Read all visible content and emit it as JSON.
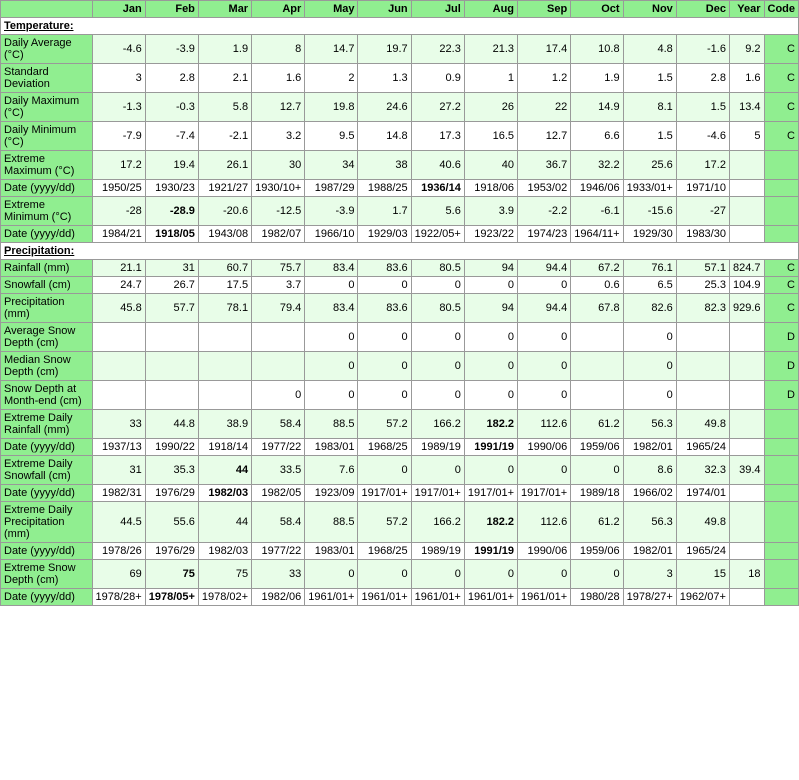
{
  "headers": [
    "",
    "Jan",
    "Feb",
    "Mar",
    "Apr",
    "May",
    "Jun",
    "Jul",
    "Aug",
    "Sep",
    "Oct",
    "Nov",
    "Dec",
    "Year",
    "Code"
  ],
  "sections": [
    {
      "title": "Temperature:",
      "rows": [
        {
          "label": "Daily Average (°C)",
          "values": [
            "-4.6",
            "-3.9",
            "1.9",
            "8",
            "14.7",
            "19.7",
            "22.3",
            "21.3",
            "17.4",
            "10.8",
            "4.8",
            "-1.6",
            "9.2",
            "C"
          ]
        },
        {
          "label": "Standard Deviation",
          "values": [
            "3",
            "2.8",
            "2.1",
            "1.6",
            "2",
            "1.3",
            "0.9",
            "1",
            "1.2",
            "1.9",
            "1.5",
            "2.8",
            "1.6",
            "C"
          ]
        },
        {
          "label": "Daily Maximum (°C)",
          "values": [
            "-1.3",
            "-0.3",
            "5.8",
            "12.7",
            "19.8",
            "24.6",
            "27.2",
            "26",
            "22",
            "14.9",
            "8.1",
            "1.5",
            "13.4",
            "C"
          ]
        },
        {
          "label": "Daily Minimum (°C)",
          "values": [
            "-7.9",
            "-7.4",
            "-2.1",
            "3.2",
            "9.5",
            "14.8",
            "17.3",
            "16.5",
            "12.7",
            "6.6",
            "1.5",
            "-4.6",
            "5",
            "C"
          ]
        },
        {
          "label": "Extreme Maximum (°C)",
          "values": [
            "17.2",
            "19.4",
            "26.1",
            "30",
            "34",
            "38",
            "40.6",
            "40",
            "36.7",
            "32.2",
            "25.6",
            "17.2",
            "",
            ""
          ]
        },
        {
          "label": "Date (yyyy/dd)",
          "values": [
            "1950/25",
            "1930/23",
            "1921/27",
            "1930/10+",
            "1987/29",
            "1988/25",
            "1936/14",
            "1918/06",
            "1953/02",
            "1946/06",
            "1933/01+",
            "1971/10",
            "",
            ""
          ],
          "bold_indices": [
            6
          ]
        },
        {
          "label": "Extreme Minimum (°C)",
          "values": [
            "-28",
            "-28.9",
            "-20.6",
            "-12.5",
            "-3.9",
            "1.7",
            "5.6",
            "3.9",
            "-2.2",
            "-6.1",
            "-15.6",
            "-27",
            "",
            ""
          ],
          "bold_indices": [
            1
          ]
        },
        {
          "label": "Date (yyyy/dd)",
          "values": [
            "1984/21",
            "1918/05",
            "1943/08",
            "1982/07",
            "1966/10",
            "1929/03",
            "1922/05+",
            "1923/22",
            "1974/23",
            "1964/11+",
            "1929/30",
            "1983/30",
            "",
            ""
          ],
          "bold_indices": [
            1
          ]
        }
      ]
    },
    {
      "title": "Precipitation:",
      "rows": [
        {
          "label": "Rainfall (mm)",
          "values": [
            "21.1",
            "31",
            "60.7",
            "75.7",
            "83.4",
            "83.6",
            "80.5",
            "94",
            "94.4",
            "67.2",
            "76.1",
            "57.1",
            "824.7",
            "C"
          ]
        },
        {
          "label": "Snowfall (cm)",
          "values": [
            "24.7",
            "26.7",
            "17.5",
            "3.7",
            "0",
            "0",
            "0",
            "0",
            "0",
            "0.6",
            "6.5",
            "25.3",
            "104.9",
            "C"
          ]
        },
        {
          "label": "Precipitation (mm)",
          "values": [
            "45.8",
            "57.7",
            "78.1",
            "79.4",
            "83.4",
            "83.6",
            "80.5",
            "94",
            "94.4",
            "67.8",
            "82.6",
            "82.3",
            "929.6",
            "C"
          ]
        },
        {
          "label": "Average Snow Depth (cm)",
          "values": [
            "",
            "",
            "",
            "",
            "0",
            "0",
            "0",
            "0",
            "0",
            "",
            "0",
            "",
            "",
            "D"
          ]
        },
        {
          "label": "Median Snow Depth (cm)",
          "values": [
            "",
            "",
            "",
            "",
            "0",
            "0",
            "0",
            "0",
            "0",
            "",
            "0",
            "",
            "",
            "D"
          ]
        },
        {
          "label": "Snow Depth at Month-end (cm)",
          "values": [
            "",
            "",
            "",
            "0",
            "0",
            "0",
            "0",
            "0",
            "0",
            "",
            "0",
            "",
            "",
            "D"
          ]
        },
        {
          "label": "Extreme Daily Rainfall (mm)",
          "values": [
            "33",
            "44.8",
            "38.9",
            "58.4",
            "88.5",
            "57.2",
            "166.2",
            "182.2",
            "112.6",
            "61.2",
            "56.3",
            "49.8",
            "",
            ""
          ],
          "bold_indices": [
            7
          ]
        },
        {
          "label": "Date (yyyy/dd)",
          "values": [
            "1937/13",
            "1990/22",
            "1918/14",
            "1977/22",
            "1983/01",
            "1968/25",
            "1989/19",
            "1991/19",
            "1990/06",
            "1959/06",
            "1982/01",
            "1965/24",
            "",
            ""
          ],
          "bold_indices": [
            7
          ]
        },
        {
          "label": "Extreme Daily Snowfall (cm)",
          "values": [
            "31",
            "35.3",
            "44",
            "33.5",
            "7.6",
            "0",
            "0",
            "0",
            "0",
            "0",
            "8.6",
            "32.3",
            "39.4",
            ""
          ],
          "bold_indices": [
            2
          ]
        },
        {
          "label": "Date (yyyy/dd)",
          "values": [
            "1982/31",
            "1976/29",
            "1982/03",
            "1982/05",
            "1923/09",
            "1917/01+",
            "1917/01+",
            "1917/01+",
            "1917/01+",
            "1989/18",
            "1966/02",
            "1974/01",
            "",
            ""
          ],
          "bold_indices": [
            2
          ]
        },
        {
          "label": "Extreme Daily Precipitation (mm)",
          "values": [
            "44.5",
            "55.6",
            "44",
            "58.4",
            "88.5",
            "57.2",
            "166.2",
            "182.2",
            "112.6",
            "61.2",
            "56.3",
            "49.8",
            "",
            ""
          ],
          "bold_indices": [
            7
          ]
        },
        {
          "label": "Date (yyyy/dd)",
          "values": [
            "1978/26",
            "1976/29",
            "1982/03",
            "1977/22",
            "1983/01",
            "1968/25",
            "1989/19",
            "1991/19",
            "1990/06",
            "1959/06",
            "1982/01",
            "1965/24",
            "",
            ""
          ],
          "bold_indices": [
            7
          ]
        },
        {
          "label": "Extreme Snow Depth (cm)",
          "values": [
            "69",
            "75",
            "75",
            "33",
            "0",
            "0",
            "0",
            "0",
            "0",
            "0",
            "3",
            "15",
            "18",
            ""
          ],
          "bold_indices": [
            1
          ]
        },
        {
          "label": "Date (yyyy/dd)",
          "values": [
            "1978/28+",
            "1978/05+",
            "1978/02+",
            "1982/06",
            "1961/01+",
            "1961/01+",
            "1961/01+",
            "1961/01+",
            "1961/01+",
            "1980/28",
            "1978/27+",
            "1962/07+",
            "",
            ""
          ],
          "bold_indices": [
            1
          ]
        }
      ]
    }
  ]
}
